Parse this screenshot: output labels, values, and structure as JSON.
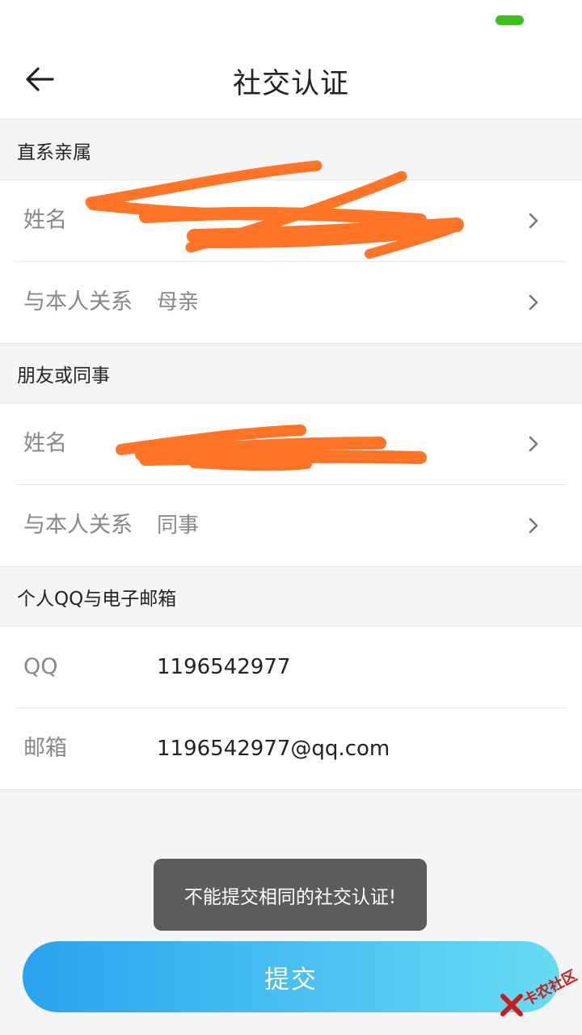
{
  "header": {
    "title": "社交认证"
  },
  "sections": {
    "family": {
      "header": "直系亲属",
      "name": {
        "label": "姓名",
        "value": ""
      },
      "relation": {
        "label": "与本人关系",
        "value": "母亲"
      }
    },
    "friend": {
      "header": "朋友或同事",
      "name": {
        "label": "姓名",
        "value": ""
      },
      "relation": {
        "label": "与本人关系",
        "value": "同事"
      }
    },
    "personal": {
      "header": "个人QQ与电子邮箱",
      "qq": {
        "label": "QQ",
        "value": "1196542977"
      },
      "email": {
        "label": "邮箱",
        "value": "1196542977@qq.com"
      }
    }
  },
  "toast": "不能提交相同的社交认证!",
  "submit_label": "提交",
  "watermark": "卡农社区",
  "colors": {
    "accent_start": "#2aa3ee",
    "accent_end": "#66dcf3",
    "redaction": "#ff7426",
    "battery": "#3cc11a"
  },
  "icons": [
    "back-arrow-icon",
    "chevron-right-icon",
    "battery-icon"
  ]
}
